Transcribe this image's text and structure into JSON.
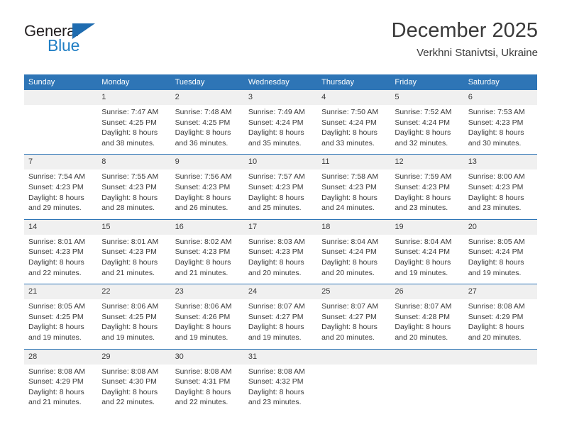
{
  "brand": {
    "name_part1": "General",
    "name_part2": "Blue",
    "triangle_color": "#1f6cb0",
    "blue_color": "#1f7ec4"
  },
  "header": {
    "month_title": "December 2025",
    "location": "Verkhni Stanivtsi, Ukraine"
  },
  "theme": {
    "header_bar_color": "#2e75b6",
    "daynum_background": "#f0f0f0",
    "text_color": "#3a3a3a"
  },
  "columns": [
    "Sunday",
    "Monday",
    "Tuesday",
    "Wednesday",
    "Thursday",
    "Friday",
    "Saturday"
  ],
  "weeks": [
    [
      {
        "day": "",
        "empty": true
      },
      {
        "day": "1",
        "sunrise": "Sunrise: 7:47 AM",
        "sunset": "Sunset: 4:25 PM",
        "daylight1": "Daylight: 8 hours",
        "daylight2": "and 38 minutes."
      },
      {
        "day": "2",
        "sunrise": "Sunrise: 7:48 AM",
        "sunset": "Sunset: 4:25 PM",
        "daylight1": "Daylight: 8 hours",
        "daylight2": "and 36 minutes."
      },
      {
        "day": "3",
        "sunrise": "Sunrise: 7:49 AM",
        "sunset": "Sunset: 4:24 PM",
        "daylight1": "Daylight: 8 hours",
        "daylight2": "and 35 minutes."
      },
      {
        "day": "4",
        "sunrise": "Sunrise: 7:50 AM",
        "sunset": "Sunset: 4:24 PM",
        "daylight1": "Daylight: 8 hours",
        "daylight2": "and 33 minutes."
      },
      {
        "day": "5",
        "sunrise": "Sunrise: 7:52 AM",
        "sunset": "Sunset: 4:24 PM",
        "daylight1": "Daylight: 8 hours",
        "daylight2": "and 32 minutes."
      },
      {
        "day": "6",
        "sunrise": "Sunrise: 7:53 AM",
        "sunset": "Sunset: 4:23 PM",
        "daylight1": "Daylight: 8 hours",
        "daylight2": "and 30 minutes."
      }
    ],
    [
      {
        "day": "7",
        "sunrise": "Sunrise: 7:54 AM",
        "sunset": "Sunset: 4:23 PM",
        "daylight1": "Daylight: 8 hours",
        "daylight2": "and 29 minutes."
      },
      {
        "day": "8",
        "sunrise": "Sunrise: 7:55 AM",
        "sunset": "Sunset: 4:23 PM",
        "daylight1": "Daylight: 8 hours",
        "daylight2": "and 28 minutes."
      },
      {
        "day": "9",
        "sunrise": "Sunrise: 7:56 AM",
        "sunset": "Sunset: 4:23 PM",
        "daylight1": "Daylight: 8 hours",
        "daylight2": "and 26 minutes."
      },
      {
        "day": "10",
        "sunrise": "Sunrise: 7:57 AM",
        "sunset": "Sunset: 4:23 PM",
        "daylight1": "Daylight: 8 hours",
        "daylight2": "and 25 minutes."
      },
      {
        "day": "11",
        "sunrise": "Sunrise: 7:58 AM",
        "sunset": "Sunset: 4:23 PM",
        "daylight1": "Daylight: 8 hours",
        "daylight2": "and 24 minutes."
      },
      {
        "day": "12",
        "sunrise": "Sunrise: 7:59 AM",
        "sunset": "Sunset: 4:23 PM",
        "daylight1": "Daylight: 8 hours",
        "daylight2": "and 23 minutes."
      },
      {
        "day": "13",
        "sunrise": "Sunrise: 8:00 AM",
        "sunset": "Sunset: 4:23 PM",
        "daylight1": "Daylight: 8 hours",
        "daylight2": "and 23 minutes."
      }
    ],
    [
      {
        "day": "14",
        "sunrise": "Sunrise: 8:01 AM",
        "sunset": "Sunset: 4:23 PM",
        "daylight1": "Daylight: 8 hours",
        "daylight2": "and 22 minutes."
      },
      {
        "day": "15",
        "sunrise": "Sunrise: 8:01 AM",
        "sunset": "Sunset: 4:23 PM",
        "daylight1": "Daylight: 8 hours",
        "daylight2": "and 21 minutes."
      },
      {
        "day": "16",
        "sunrise": "Sunrise: 8:02 AM",
        "sunset": "Sunset: 4:23 PM",
        "daylight1": "Daylight: 8 hours",
        "daylight2": "and 21 minutes."
      },
      {
        "day": "17",
        "sunrise": "Sunrise: 8:03 AM",
        "sunset": "Sunset: 4:23 PM",
        "daylight1": "Daylight: 8 hours",
        "daylight2": "and 20 minutes."
      },
      {
        "day": "18",
        "sunrise": "Sunrise: 8:04 AM",
        "sunset": "Sunset: 4:24 PM",
        "daylight1": "Daylight: 8 hours",
        "daylight2": "and 20 minutes."
      },
      {
        "day": "19",
        "sunrise": "Sunrise: 8:04 AM",
        "sunset": "Sunset: 4:24 PM",
        "daylight1": "Daylight: 8 hours",
        "daylight2": "and 19 minutes."
      },
      {
        "day": "20",
        "sunrise": "Sunrise: 8:05 AM",
        "sunset": "Sunset: 4:24 PM",
        "daylight1": "Daylight: 8 hours",
        "daylight2": "and 19 minutes."
      }
    ],
    [
      {
        "day": "21",
        "sunrise": "Sunrise: 8:05 AM",
        "sunset": "Sunset: 4:25 PM",
        "daylight1": "Daylight: 8 hours",
        "daylight2": "and 19 minutes."
      },
      {
        "day": "22",
        "sunrise": "Sunrise: 8:06 AM",
        "sunset": "Sunset: 4:25 PM",
        "daylight1": "Daylight: 8 hours",
        "daylight2": "and 19 minutes."
      },
      {
        "day": "23",
        "sunrise": "Sunrise: 8:06 AM",
        "sunset": "Sunset: 4:26 PM",
        "daylight1": "Daylight: 8 hours",
        "daylight2": "and 19 minutes."
      },
      {
        "day": "24",
        "sunrise": "Sunrise: 8:07 AM",
        "sunset": "Sunset: 4:27 PM",
        "daylight1": "Daylight: 8 hours",
        "daylight2": "and 19 minutes."
      },
      {
        "day": "25",
        "sunrise": "Sunrise: 8:07 AM",
        "sunset": "Sunset: 4:27 PM",
        "daylight1": "Daylight: 8 hours",
        "daylight2": "and 20 minutes."
      },
      {
        "day": "26",
        "sunrise": "Sunrise: 8:07 AM",
        "sunset": "Sunset: 4:28 PM",
        "daylight1": "Daylight: 8 hours",
        "daylight2": "and 20 minutes."
      },
      {
        "day": "27",
        "sunrise": "Sunrise: 8:08 AM",
        "sunset": "Sunset: 4:29 PM",
        "daylight1": "Daylight: 8 hours",
        "daylight2": "and 20 minutes."
      }
    ],
    [
      {
        "day": "28",
        "sunrise": "Sunrise: 8:08 AM",
        "sunset": "Sunset: 4:29 PM",
        "daylight1": "Daylight: 8 hours",
        "daylight2": "and 21 minutes."
      },
      {
        "day": "29",
        "sunrise": "Sunrise: 8:08 AM",
        "sunset": "Sunset: 4:30 PM",
        "daylight1": "Daylight: 8 hours",
        "daylight2": "and 22 minutes."
      },
      {
        "day": "30",
        "sunrise": "Sunrise: 8:08 AM",
        "sunset": "Sunset: 4:31 PM",
        "daylight1": "Daylight: 8 hours",
        "daylight2": "and 22 minutes."
      },
      {
        "day": "31",
        "sunrise": "Sunrise: 8:08 AM",
        "sunset": "Sunset: 4:32 PM",
        "daylight1": "Daylight: 8 hours",
        "daylight2": "and 23 minutes."
      },
      {
        "day": "",
        "empty": true
      },
      {
        "day": "",
        "empty": true
      },
      {
        "day": "",
        "empty": true
      }
    ]
  ]
}
